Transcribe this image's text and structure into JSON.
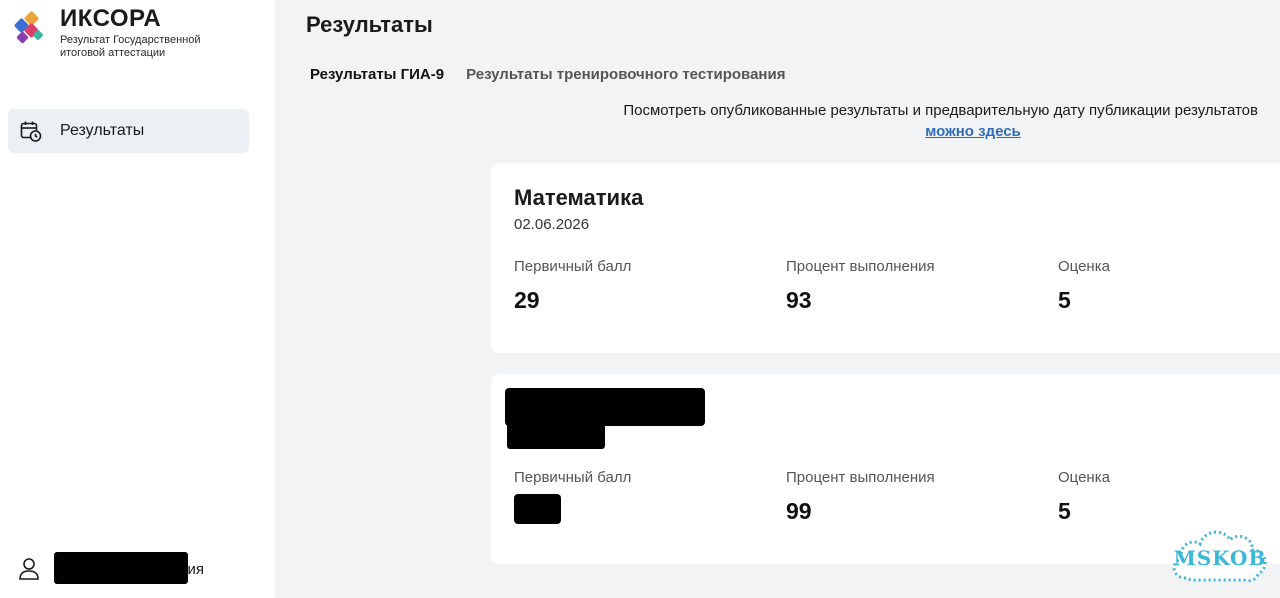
{
  "app": {
    "logo_title": "ИКСОРА",
    "logo_subtitle": "Результат Государственной итоговой аттестации"
  },
  "sidebar": {
    "items": [
      {
        "label": "Результаты",
        "icon": "calendar-clock-icon",
        "active": true
      }
    ],
    "user": {
      "name_suffix": "ия",
      "icon": "user-icon"
    }
  },
  "main": {
    "title": "Результаты",
    "tabs": [
      {
        "label": "Результаты ГИА-9",
        "active": true
      },
      {
        "label": "Результаты тренировочного тестирования",
        "active": false
      }
    ],
    "notice_text": "Посмотреть опубликованные результаты и предварительную дату публикации результатов",
    "notice_link": "можно здесь"
  },
  "cards": [
    {
      "subject": "Математика",
      "date": "02.06.2026",
      "columns": [
        {
          "label": "Первичный балл",
          "value": "29"
        },
        {
          "label": "Процент выполнения",
          "value": "93"
        },
        {
          "label": "Оценка",
          "value": "5"
        }
      ]
    },
    {
      "subject": "",
      "date": "",
      "columns": [
        {
          "label": "Первичный балл",
          "value": ""
        },
        {
          "label": "Процент выполнения",
          "value": "99"
        },
        {
          "label": "Оценка",
          "value": "5"
        }
      ]
    }
  ],
  "watermark": {
    "text": "MSKOB"
  },
  "colors": {
    "accent": "#2f6bb8",
    "nav_active_bg": "#ebf0f4",
    "page_bg": "#f2f3f5",
    "watermark": "#39b8d8"
  }
}
